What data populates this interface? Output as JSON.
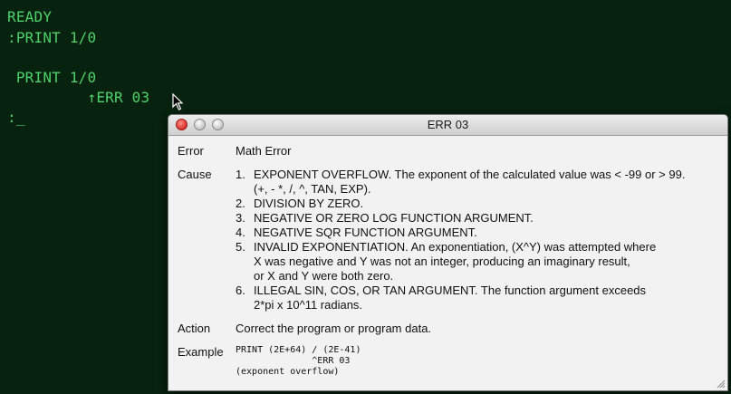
{
  "terminal": {
    "lines": [
      {
        "text": "READY"
      },
      {
        "text": ":PRINT 1/0"
      },
      {
        "text": " PRINT 1/0"
      },
      {
        "text": "         ↑ERR 03"
      },
      {
        "text": ":_"
      }
    ]
  },
  "window": {
    "title": "ERR 03",
    "error_label": "Error",
    "error_value": "Math Error",
    "cause_label": "Cause",
    "causes": [
      {
        "num": "1.",
        "text": "EXPONENT OVERFLOW. The exponent of the calculated value was < -99 or > 99.\n(+, - *, /, ^, TAN, EXP)."
      },
      {
        "num": "2.",
        "text": "DIVISION BY ZERO."
      },
      {
        "num": "3.",
        "text": "NEGATIVE OR ZERO LOG FUNCTION ARGUMENT."
      },
      {
        "num": "4.",
        "text": "NEGATIVE SQR FUNCTION ARGUMENT."
      },
      {
        "num": "5.",
        "text": "INVALID EXPONENTIATION. An exponentiation, (X^Y) was attempted where\nX was negative and Y was not an integer, producing an imaginary result,\nor X and Y were both zero."
      },
      {
        "num": "6.",
        "text": "ILLEGAL SIN, COS, OR TAN ARGUMENT. The function argument exceeds\n2*pi x 10^11 radians."
      }
    ],
    "action_label": "Action",
    "action_value": "Correct the program or program data.",
    "example_label": "Example",
    "example_code": "PRINT (2E+64) / (2E-41)\n              ^ERR 03\n(exponent overflow)"
  },
  "colors": {
    "terminal_bg": "#07220f",
    "terminal_text": "#4fd26a",
    "close_button": "#d8302b"
  }
}
